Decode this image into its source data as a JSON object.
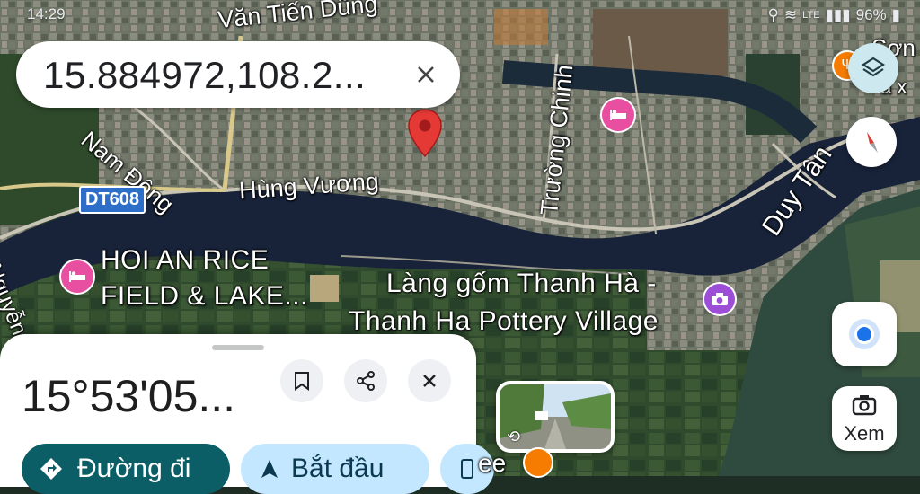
{
  "status_bar": {
    "time": "14:29",
    "net": "LTE",
    "battery": "96%"
  },
  "search": {
    "value": "15.884972,108.2..."
  },
  "map_labels": {
    "van_tien_dung": "Văn Tiến Dũng",
    "nam_dong": "Nam Đông",
    "hung_vuong": "Hùng Vương",
    "dt608": "DT608",
    "truong_chinh": "Trường Chinh",
    "duy_tan": "Duy Tân",
    "nguyen": "Nguyễn",
    "son": "Sơn",
    "ax": "a x",
    "ee": "ee"
  },
  "pois": {
    "rice_field": {
      "line1": "HOI AN RICE",
      "line2": "FIELD & LAKE..."
    },
    "pottery": {
      "line1": "Làng gốm Thanh Hà -",
      "line2": "Thanh Ha Pottery Village"
    }
  },
  "sheet": {
    "coordinates": "15°53'05...",
    "directions_label": "Đường đi",
    "start_label": "Bắt đầu"
  },
  "controls": {
    "explore_label": "Xem"
  },
  "colors": {
    "accent_teal": "#0b5e66",
    "start_bg": "#c2e7ff",
    "pin_red": "#e53935",
    "poi_pink": "#e84fa0",
    "poi_purple": "#9c4fd6",
    "location_blue": "#1a73e8"
  }
}
